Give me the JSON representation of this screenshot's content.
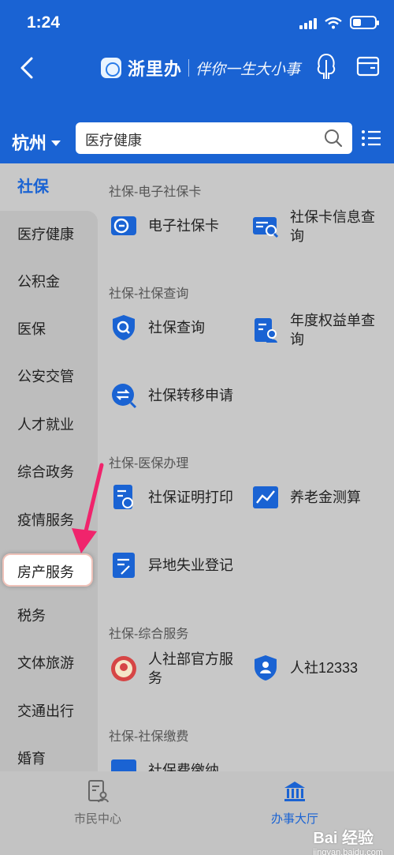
{
  "status": {
    "time": "1:24"
  },
  "header": {
    "brand": "浙里办",
    "slogan": "伴你一生大小事"
  },
  "search": {
    "city": "杭州",
    "value": "医疗健康"
  },
  "sidebar": {
    "active": "社保",
    "items": [
      "医疗健康",
      "公积金",
      "医保",
      "公安交管",
      "人才就业",
      "综合政务",
      "疫情服务",
      "房产服务",
      "税务",
      "文体旅游",
      "交通出行",
      "婚育"
    ],
    "highlighted": "房产服务"
  },
  "sections": [
    {
      "title": "社保-电子社保卡",
      "services": [
        "电子社保卡",
        "社保卡信息查\n询"
      ]
    },
    {
      "title": "社保-社保查询",
      "services": [
        "社保查询",
        "年度权益单查\n询",
        "社保转移申请"
      ]
    },
    {
      "title": "社保-医保办理",
      "services": [
        "社保证明打印",
        "养老金测算",
        "异地失业登记"
      ]
    },
    {
      "title": "社保-综合服务",
      "services": [
        "人社部官方服\n务",
        "人社12333"
      ]
    },
    {
      "title": "社保-社保缴费",
      "services": [
        "社保费缴纳"
      ]
    }
  ],
  "tabbar": {
    "tabs": [
      "市民中心",
      "办事大厅"
    ]
  },
  "watermark": {
    "main": "Bai 经验",
    "sub": "jingyan.baidu.com"
  },
  "colors": {
    "brand": "#1a63d3",
    "highlight_border": "#efc2b9",
    "arrow": "#f0246c"
  }
}
